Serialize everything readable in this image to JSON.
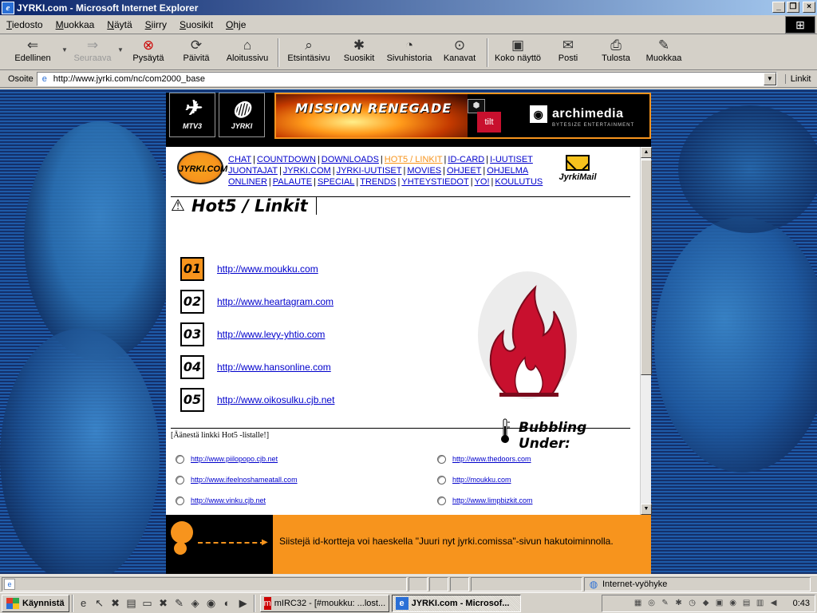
{
  "window": {
    "title": "JYRKI.com - Microsoft Internet Explorer",
    "minimize": "_",
    "maximize": "❐",
    "close": "×"
  },
  "menu": [
    "Tiedosto",
    "Muokkaa",
    "Näytä",
    "Siirry",
    "Suosikit",
    "Ohje"
  ],
  "toolbar": {
    "back": "Edellinen",
    "forward": "Seuraava",
    "stop": "Pysäytä",
    "refresh": "Päivitä",
    "home": "Aloitussivu",
    "search": "Etsintäsivu",
    "favorites": "Suosikit",
    "history": "Sivuhistoria",
    "channels": "Kanavat",
    "fullscreen": "Koko näyttö",
    "mail": "Posti",
    "print": "Tulosta",
    "edit": "Muokkaa"
  },
  "address": {
    "label": "Osoite",
    "url": "http://www.jyrki.com/nc/com2000_base",
    "links": "Linkit"
  },
  "site": {
    "header_logo1": "MTV3",
    "header_logo2": "JYRKI",
    "banner_title": "MISSION RENEGADE",
    "banner_tilt": "tilt",
    "banner_brand": "archimedia",
    "banner_brand_sub": "BYTESIZE ENTERTAINMENT",
    "jyrki_logo": "JYRKI.COM",
    "nav_rows": [
      [
        "CHAT",
        "COUNTDOWN",
        "DOWNLOADS",
        "HOT5 / LINKIT",
        "ID-CARD",
        "I-UUTISET"
      ],
      [
        "JUONTAJAT",
        "JYRKI.COM",
        "JYRKI-UUTISET",
        "MOVIES",
        "OHJEET",
        "OHJELMA"
      ],
      [
        "ONLINER",
        "PALAUTE",
        "SPECIAL",
        "TRENDS",
        "YHTEYSTIEDOT",
        "YO!",
        "KOULUTUS"
      ]
    ],
    "active_nav": "HOT5 / LINKIT",
    "mail_label": "JyrkiMail",
    "section_title": "Hot5 / Linkit",
    "hot5": [
      {
        "num": "01",
        "url": "http://www.moukku.com"
      },
      {
        "num": "02",
        "url": "http://www.heartagram.com"
      },
      {
        "num": "03",
        "url": "http://www.levy-yhtio.com"
      },
      {
        "num": "04",
        "url": "http://www.hansonline.com"
      },
      {
        "num": "05",
        "url": "http://www.oikosulku.cjb.net"
      }
    ],
    "vote_text": "[Äänestä linkki Hot5 -listalle!]",
    "bubbling_title": "Bubbling Under:",
    "bubbling": [
      "http://www.piilopopo.cjb.net",
      "http://www.thedoors.com",
      "http://www.ifeelnoshameatall.com",
      "http://moukku.com",
      "http://www.vinku.cjb.net",
      "http://www.limpbizkit.com"
    ],
    "promo_text": "Siistejä id-kortteja voi haeskella \"Juuri nyt jyrki.comissa\"-sivun hakutoiminnolla."
  },
  "status": {
    "zone": "Internet-vyöhyke"
  },
  "taskbar": {
    "start": "Käynnistä",
    "tasks": [
      {
        "label": "mIRC32 - [#moukku: ...lost..."
      },
      {
        "label": "JYRKI.com - Microsof..."
      }
    ],
    "clock": "0:43"
  }
}
